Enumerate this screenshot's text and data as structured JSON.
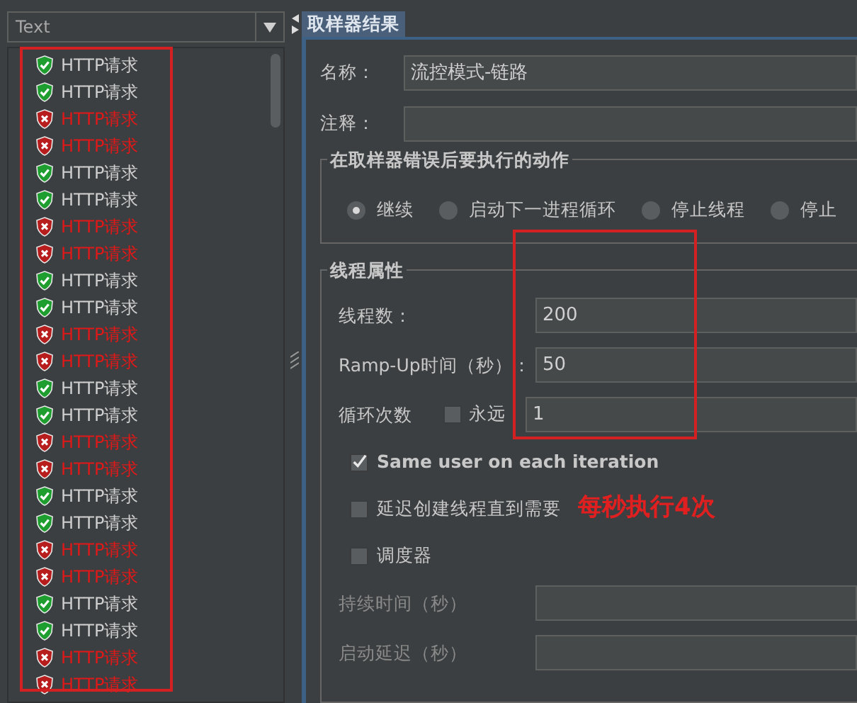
{
  "left_panel": {
    "view_selector": {
      "value": "Text"
    },
    "results": [
      {
        "label": "HTTP请求",
        "passed": true
      },
      {
        "label": "HTTP请求",
        "passed": true
      },
      {
        "label": "HTTP请求",
        "passed": false
      },
      {
        "label": "HTTP请求",
        "passed": false
      },
      {
        "label": "HTTP请求",
        "passed": true
      },
      {
        "label": "HTTP请求",
        "passed": true
      },
      {
        "label": "HTTP请求",
        "passed": false
      },
      {
        "label": "HTTP请求",
        "passed": false
      },
      {
        "label": "HTTP请求",
        "passed": true
      },
      {
        "label": "HTTP请求",
        "passed": true
      },
      {
        "label": "HTTP请求",
        "passed": false
      },
      {
        "label": "HTTP请求",
        "passed": false
      },
      {
        "label": "HTTP请求",
        "passed": true
      },
      {
        "label": "HTTP请求",
        "passed": true
      },
      {
        "label": "HTTP请求",
        "passed": false
      },
      {
        "label": "HTTP请求",
        "passed": false
      },
      {
        "label": "HTTP请求",
        "passed": true
      },
      {
        "label": "HTTP请求",
        "passed": true
      },
      {
        "label": "HTTP请求",
        "passed": false
      },
      {
        "label": "HTTP请求",
        "passed": false
      },
      {
        "label": "HTTP请求",
        "passed": true
      },
      {
        "label": "HTTP请求",
        "passed": true
      },
      {
        "label": "HTTP请求",
        "passed": false
      },
      {
        "label": "HTTP请求",
        "passed": false
      }
    ]
  },
  "right_panel": {
    "tab": {
      "label": "取样器结果",
      "selected": true
    },
    "name": {
      "label": "名称：",
      "value": "流控模式-链路"
    },
    "comment": {
      "label": "注释："
    },
    "error_action": {
      "title": "在取样器错误后要执行的动作",
      "options": [
        {
          "label": "继续",
          "selected": true
        },
        {
          "label": "启动下一进程循环",
          "selected": false
        },
        {
          "label": "停止线程",
          "selected": false
        },
        {
          "label": "停止",
          "selected": false
        }
      ]
    },
    "thread_props": {
      "title": "线程属性",
      "threads": {
        "label": "线程数：",
        "value": "200"
      },
      "ramp_up": {
        "label": "Ramp-Up时间（秒）：",
        "value": "50"
      },
      "loop": {
        "label": "循环次数",
        "forever": {
          "label": "永远",
          "checked": false
        },
        "value": "1"
      },
      "checks": [
        {
          "label": "Same user on each iteration",
          "checked": true
        },
        {
          "label": "延迟创建线程直到需要",
          "checked": false
        },
        {
          "label": "调度器",
          "checked": false
        }
      ],
      "duration": {
        "label": "持续时间（秒）",
        "disabled": true
      },
      "startup_delay": {
        "label": "启动延迟（秒）",
        "disabled": true
      }
    }
  },
  "annotation": {
    "text": "每秒执行4次"
  }
}
